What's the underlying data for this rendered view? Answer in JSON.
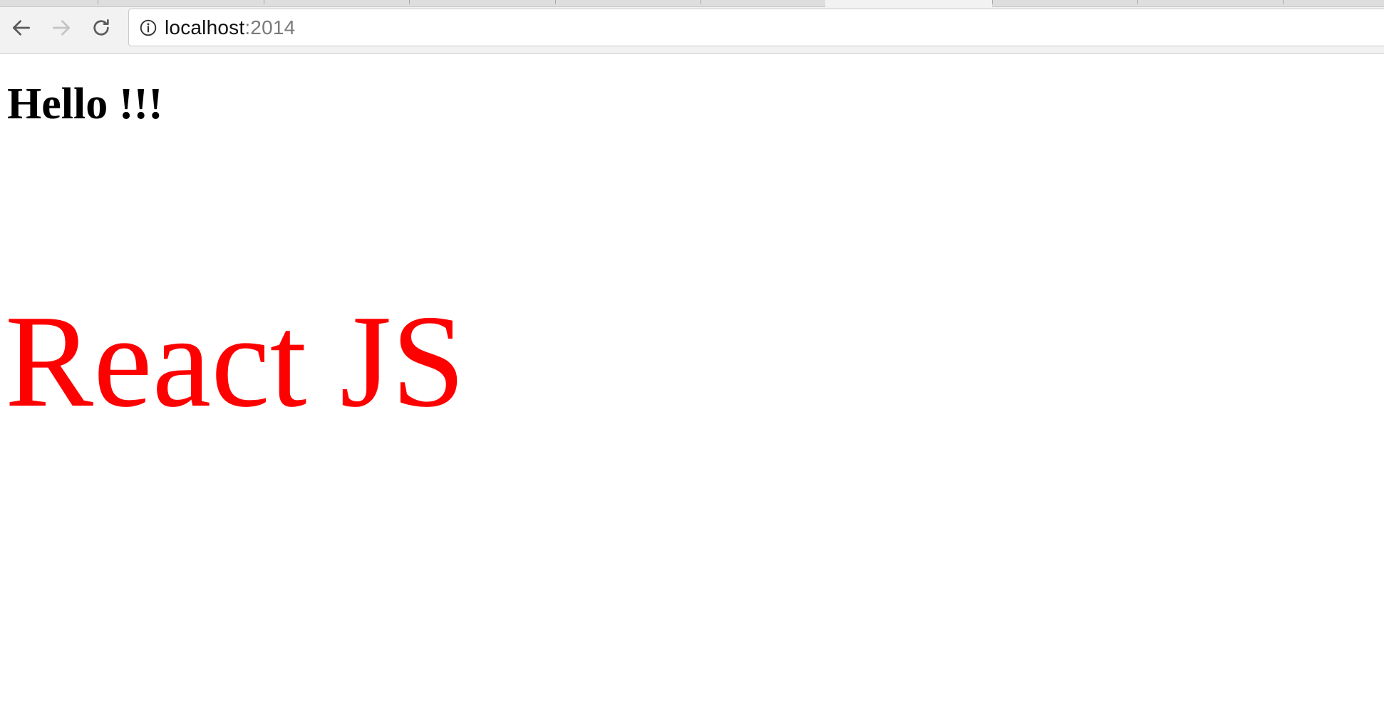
{
  "browser": {
    "address_bar": {
      "host": "localhost",
      "port": ":2014"
    },
    "icons": {
      "back": "arrow-left-icon",
      "forward": "arrow-right-icon",
      "reload": "reload-icon",
      "site_info": "info-circle-icon"
    },
    "forward_enabled": false
  },
  "page": {
    "heading": "Hello !!!",
    "title": "React JS",
    "colors": {
      "heading": "#000000",
      "title": "#ff0000"
    }
  }
}
